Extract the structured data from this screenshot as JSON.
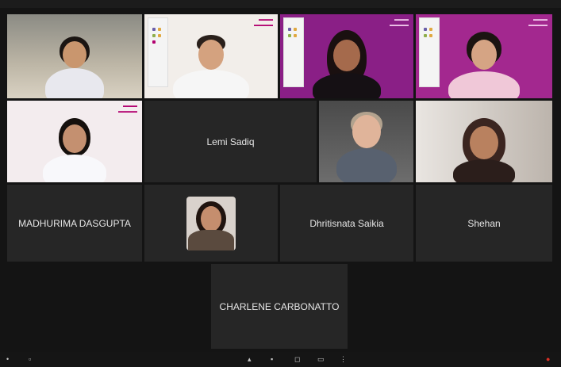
{
  "participants": {
    "lemi": "Lemi Sadiq",
    "madhurima": "MADHURIMA DASGUPTA",
    "dhritisnata": "Dhritisnata Saikia",
    "shehan": "Shehan",
    "charlene": "CHARLENE CARBONATTO"
  },
  "toolbar": {
    "icons": [
      "mic-icon",
      "camera-icon",
      "captions-icon",
      "emoji-icon",
      "present-icon",
      "hand-icon",
      "more-icon",
      "end-call-icon"
    ]
  },
  "colors": {
    "tile_bg": "#262626",
    "page_bg": "#141414",
    "brand_magenta": "#b2006f",
    "end_call_red": "#d93025"
  }
}
